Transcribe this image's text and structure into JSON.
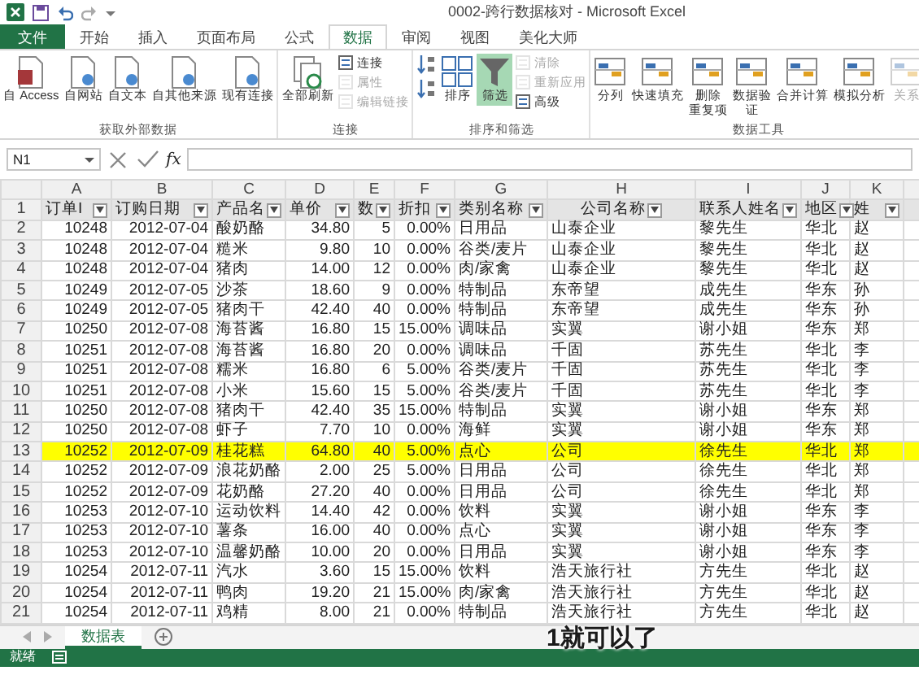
{
  "title_bar": {
    "title": "0002-跨行数据核对 - Microsoft Excel"
  },
  "ribbon_tabs": [
    {
      "label": "文件",
      "kind": "file",
      "selected": false
    },
    {
      "label": "开始",
      "kind": "tab",
      "selected": false
    },
    {
      "label": "插入",
      "kind": "tab",
      "selected": false
    },
    {
      "label": "页面布局",
      "kind": "tab",
      "selected": false
    },
    {
      "label": "公式",
      "kind": "tab",
      "selected": false
    },
    {
      "label": "数据",
      "kind": "tab",
      "selected": true
    },
    {
      "label": "审阅",
      "kind": "tab",
      "selected": false
    },
    {
      "label": "视图",
      "kind": "tab",
      "selected": false
    },
    {
      "label": "美化大师",
      "kind": "tab",
      "selected": false
    }
  ],
  "ribbon_groups": [
    {
      "label": "获取外部数据",
      "items": [
        {
          "label": "自 Access",
          "kind": "large",
          "disabled": false,
          "selected": false
        },
        {
          "label": "自网站",
          "kind": "large",
          "disabled": false,
          "selected": false
        },
        {
          "label": "自文本",
          "kind": "large",
          "disabled": false,
          "selected": false
        },
        {
          "label": "自其他来源",
          "kind": "large",
          "disabled": false,
          "selected": false
        },
        {
          "label": "现有连接",
          "kind": "large",
          "disabled": false,
          "selected": false
        }
      ]
    },
    {
      "label": "连接",
      "items": [
        {
          "label": "全部刷新",
          "kind": "large",
          "disabled": false,
          "selected": false
        },
        {
          "label": "连接",
          "kind": "small",
          "disabled": false,
          "selected": false
        },
        {
          "label": "属性",
          "kind": "small",
          "disabled": true,
          "selected": false
        },
        {
          "label": "编辑链接",
          "kind": "small",
          "disabled": true,
          "selected": false
        }
      ]
    },
    {
      "label": "排序和筛选",
      "items": [
        {
          "kind": "icon",
          "disabled": false,
          "selected": false
        },
        {
          "kind": "icon",
          "disabled": false,
          "selected": false
        },
        {
          "label": "排序",
          "kind": "large",
          "disabled": false,
          "selected": false
        },
        {
          "label": "筛选",
          "kind": "large",
          "disabled": false,
          "selected": true
        },
        {
          "label": "清除",
          "kind": "small",
          "disabled": true,
          "selected": false
        },
        {
          "label": "重新应用",
          "kind": "small",
          "disabled": true,
          "selected": false
        },
        {
          "label": "高级",
          "kind": "small",
          "disabled": false,
          "selected": false
        }
      ]
    },
    {
      "label": "数据工具",
      "items": [
        {
          "label": "分列",
          "kind": "large",
          "disabled": false,
          "selected": false
        },
        {
          "label": "快速填充",
          "kind": "large",
          "disabled": false,
          "selected": false
        },
        {
          "label_lines": [
            "删除",
            "重复项"
          ],
          "kind": "large",
          "disabled": false,
          "selected": false
        },
        {
          "label_lines": [
            "数据验",
            "证"
          ],
          "kind": "large",
          "disabled": false,
          "selected": false
        },
        {
          "label": "合并计算",
          "kind": "large",
          "disabled": false,
          "selected": false
        },
        {
          "label": "模拟分析",
          "kind": "large",
          "disabled": false,
          "selected": false
        },
        {
          "label": "关系",
          "kind": "large",
          "disabled": true,
          "selected": false
        }
      ]
    }
  ],
  "formula_bar": {
    "name_box": "N1",
    "function_label": "fx"
  },
  "sheet": {
    "columns": [
      "A",
      "B",
      "C",
      "D",
      "E",
      "F",
      "G",
      "H",
      "I",
      "J",
      "K"
    ],
    "header_row": {
      "number": "1",
      "cells": [
        "订单I",
        "订购日期",
        "产品名",
        "单价",
        "数",
        "折扣",
        "类别名称",
        "公司名称",
        "联系人姓名",
        "地区",
        "姓"
      ]
    },
    "rows": [
      {
        "number": "2",
        "highlighted": false,
        "cells": [
          "10248",
          "2012-07-04",
          "酸奶酪",
          "34.80",
          "5",
          "0.00%",
          "日用品",
          "山泰企业",
          "黎先生",
          "华北",
          "赵"
        ]
      },
      {
        "number": "3",
        "highlighted": false,
        "cells": [
          "10248",
          "2012-07-04",
          "糙米",
          "9.80",
          "10",
          "0.00%",
          "谷类/麦片",
          "山泰企业",
          "黎先生",
          "华北",
          "赵"
        ]
      },
      {
        "number": "4",
        "highlighted": false,
        "cells": [
          "10248",
          "2012-07-04",
          "猪肉",
          "14.00",
          "12",
          "0.00%",
          "肉/家禽",
          "山泰企业",
          "黎先生",
          "华北",
          "赵"
        ]
      },
      {
        "number": "5",
        "highlighted": false,
        "cells": [
          "10249",
          "2012-07-05",
          "沙茶",
          "18.60",
          "9",
          "0.00%",
          "特制品",
          "东帝望",
          "成先生",
          "华东",
          "孙"
        ]
      },
      {
        "number": "6",
        "highlighted": false,
        "cells": [
          "10249",
          "2012-07-05",
          "猪肉干",
          "42.40",
          "40",
          "0.00%",
          "特制品",
          "东帝望",
          "成先生",
          "华东",
          "孙"
        ]
      },
      {
        "number": "7",
        "highlighted": false,
        "cells": [
          "10250",
          "2012-07-08",
          "海苔酱",
          "16.80",
          "15",
          "15.00%",
          "调味品",
          "实翼",
          "谢小姐",
          "华东",
          "郑"
        ]
      },
      {
        "number": "8",
        "highlighted": false,
        "cells": [
          "10251",
          "2012-07-08",
          "海苔酱",
          "16.80",
          "20",
          "0.00%",
          "调味品",
          "千固",
          "苏先生",
          "华北",
          "李"
        ]
      },
      {
        "number": "9",
        "highlighted": false,
        "cells": [
          "10251",
          "2012-07-08",
          "糯米",
          "16.80",
          "6",
          "5.00%",
          "谷类/麦片",
          "千固",
          "苏先生",
          "华北",
          "李"
        ]
      },
      {
        "number": "10",
        "highlighted": false,
        "cells": [
          "10251",
          "2012-07-08",
          "小米",
          "15.60",
          "15",
          "5.00%",
          "谷类/麦片",
          "千固",
          "苏先生",
          "华北",
          "李"
        ]
      },
      {
        "number": "11",
        "highlighted": false,
        "cells": [
          "10250",
          "2012-07-08",
          "猪肉干",
          "42.40",
          "35",
          "15.00%",
          "特制品",
          "实翼",
          "谢小姐",
          "华东",
          "郑"
        ]
      },
      {
        "number": "12",
        "highlighted": false,
        "cells": [
          "10250",
          "2012-07-08",
          "虾子",
          "7.70",
          "10",
          "0.00%",
          "海鲜",
          "实翼",
          "谢小姐",
          "华东",
          "郑"
        ]
      },
      {
        "number": "13",
        "highlighted": true,
        "cells": [
          "10252",
          "2012-07-09",
          "桂花糕",
          "64.80",
          "40",
          "5.00%",
          "点心",
          "公司",
          "徐先生",
          "华北",
          "郑"
        ]
      },
      {
        "number": "14",
        "highlighted": false,
        "cells": [
          "10252",
          "2012-07-09",
          "浪花奶酪",
          "2.00",
          "25",
          "5.00%",
          "日用品",
          "公司",
          "徐先生",
          "华北",
          "郑"
        ]
      },
      {
        "number": "15",
        "highlighted": false,
        "cells": [
          "10252",
          "2012-07-09",
          "花奶酪",
          "27.20",
          "40",
          "0.00%",
          "日用品",
          "公司",
          "徐先生",
          "华北",
          "郑"
        ]
      },
      {
        "number": "16",
        "highlighted": false,
        "cells": [
          "10253",
          "2012-07-10",
          "运动饮料",
          "14.40",
          "42",
          "0.00%",
          "饮料",
          "实翼",
          "谢小姐",
          "华东",
          "李"
        ]
      },
      {
        "number": "17",
        "highlighted": false,
        "cells": [
          "10253",
          "2012-07-10",
          "薯条",
          "16.00",
          "40",
          "0.00%",
          "点心",
          "实翼",
          "谢小姐",
          "华东",
          "李"
        ]
      },
      {
        "number": "18",
        "highlighted": false,
        "cells": [
          "10253",
          "2012-07-10",
          "温馨奶酪",
          "10.00",
          "20",
          "0.00%",
          "日用品",
          "实翼",
          "谢小姐",
          "华东",
          "李"
        ]
      },
      {
        "number": "19",
        "highlighted": false,
        "cells": [
          "10254",
          "2012-07-11",
          "汽水",
          "3.60",
          "15",
          "15.00%",
          "饮料",
          "浩天旅行社",
          "方先生",
          "华北",
          "赵"
        ]
      },
      {
        "number": "20",
        "highlighted": false,
        "cells": [
          "10254",
          "2012-07-11",
          "鸭肉",
          "19.20",
          "21",
          "15.00%",
          "肉/家禽",
          "浩天旅行社",
          "方先生",
          "华北",
          "赵"
        ]
      },
      {
        "number": "21",
        "highlighted": false,
        "cells": [
          "10254",
          "2012-07-11",
          "鸡精",
          "8.00",
          "21",
          "0.00%",
          "特制品",
          "浩天旅行社",
          "方先生",
          "华北",
          "赵"
        ]
      }
    ]
  },
  "sheet_tabs": [
    {
      "label": "数据表",
      "selected": true
    }
  ],
  "status_bar": {
    "text": "就绪"
  },
  "subtitle": "1就可以了"
}
